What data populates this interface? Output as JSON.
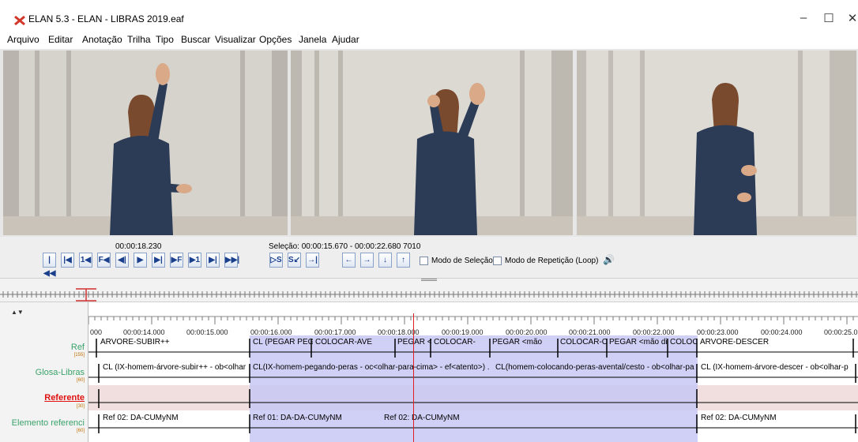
{
  "window": {
    "title": "ELAN 5.3 - ELAN - LIBRAS 2019.eaf",
    "minimize_glyph": "–",
    "maximize_glyph": "☐",
    "close_glyph": "✕"
  },
  "menu": [
    {
      "label": "Arquivo"
    },
    {
      "label": "Editar"
    },
    {
      "label": "Anotação"
    },
    {
      "label": "Trilha"
    },
    {
      "label": "Tipo"
    },
    {
      "label": "Buscar"
    },
    {
      "label": "Visualizar"
    },
    {
      "label": "Opções"
    },
    {
      "label": "Janela"
    },
    {
      "label": "Ajudar"
    }
  ],
  "player": {
    "current_time": "00:00:18.230",
    "selection": "Seleção: 00:00:15.670 - 00:00:22.680  7010",
    "buttons": [
      "|◀◀",
      "|◀",
      "1◀",
      "F◀",
      "◀|",
      "▶",
      "▶|",
      "▶F",
      "▶1",
      "▶|",
      "▶▶|"
    ],
    "selection_buttons": [
      "▷S",
      "S↙",
      "→|"
    ],
    "arrow_buttons": [
      "←",
      "→",
      "↓",
      "↑"
    ],
    "selection_mode_label": "Modo de Seleção",
    "loop_mode_label": "Modo de Repetição (Loop)",
    "volume_icon": "🔊"
  },
  "timeline": {
    "tick_labels": [
      "000",
      "00:00:14.000",
      "00:00:15.000",
      "00:00:16.000",
      "00:00:17.000",
      "00:00:18.000",
      "00:00:19.000",
      "00:00:20.000",
      "00:00:21.000",
      "00:00:22.000",
      "00:00:23.000",
      "00:00:24.000",
      "00:00:25.0"
    ],
    "tiers": [
      {
        "name": "Ref",
        "count": "[155]",
        "color": "#3aa26a"
      },
      {
        "name": "Glosa-Libras",
        "count": "[60]",
        "color": "#3aa26a"
      },
      {
        "name": "Referente",
        "count": "[30]",
        "color": "#e01010"
      },
      {
        "name": "Elemento referenci",
        "count": "[60]",
        "color": "#3aa26a"
      }
    ],
    "ref_annotations": [
      "ÁRVORE-SUBIR++",
      "CL (PEGAR PEGAR P",
      "COLOCAR-AVE",
      "PEGAR <mão di",
      "COLOCAR-",
      "PEGAR <mão",
      "COLOCAR-C",
      "PEGAR <mão di",
      "COLOC",
      "ÁRVORE-DESCER"
    ],
    "glosa_annotations": [
      "CL (IX-homem-árvore-subir++ - ob<olhar",
      "CL(IX-homem-pegando-peras - oc<olhar-para-cima> - ef<atento>)  .",
      "CL(homem-colocando-peras-avental/cesto - ob<olhar-pa",
      "CL (IX-homem-árvore-descer  -  ob<olhar-p"
    ],
    "elemento_annotations": [
      "Ref 02: DA-CUMyNM",
      "Ref 01: DA-DA-CUMyNM",
      "Ref 02: DA-CUMyNM",
      "Ref 02: DA-CUMyNM"
    ]
  },
  "colors": {
    "selection": "#c8c8f5",
    "crosshair": "#e02020",
    "referente_band": "#f1dede"
  }
}
